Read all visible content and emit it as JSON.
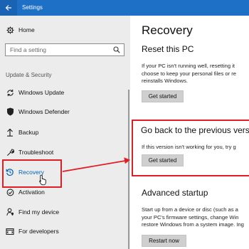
{
  "window": {
    "title": "Settings",
    "back_icon": "back-arrow-icon"
  },
  "sidebar": {
    "home_label": "Home",
    "search_placeholder": "Find a setting",
    "section_header": "Update & Security",
    "items": [
      {
        "label": "Windows Update",
        "icon": "sync-icon"
      },
      {
        "label": "Windows Defender",
        "icon": "shield-icon"
      },
      {
        "label": "Backup",
        "icon": "backup-arrow-icon"
      },
      {
        "label": "Troubleshoot",
        "icon": "wrench-icon"
      },
      {
        "label": "Recovery",
        "icon": "history-icon",
        "selected": true
      },
      {
        "label": "Activation",
        "icon": "check-circle-icon"
      },
      {
        "label": "Find my device",
        "icon": "person-location-icon"
      },
      {
        "label": "For developers",
        "icon": "developer-tools-icon"
      }
    ]
  },
  "main": {
    "page_title": "Recovery",
    "reset": {
      "heading": "Reset this PC",
      "lines": [
        "If your PC isn't running well, resetting it",
        "choose to keep your personal files or re",
        "reinstalls Windows."
      ],
      "button": "Get started"
    },
    "go_back": {
      "heading": "Go back to the previous versio",
      "line": "If this version isn't working for you, try g",
      "button": "Get started"
    },
    "advanced": {
      "heading": "Advanced startup",
      "lines": [
        "Start up from a device or disc (such as a",
        "your PC's firmware settings, change Win",
        "restore Windows from a system image. Ing"
      ],
      "button": "Restart now"
    }
  },
  "colors": {
    "titlebar": "#1e6fc6",
    "accent": "#0063b1",
    "annotation": "#e01e26"
  }
}
